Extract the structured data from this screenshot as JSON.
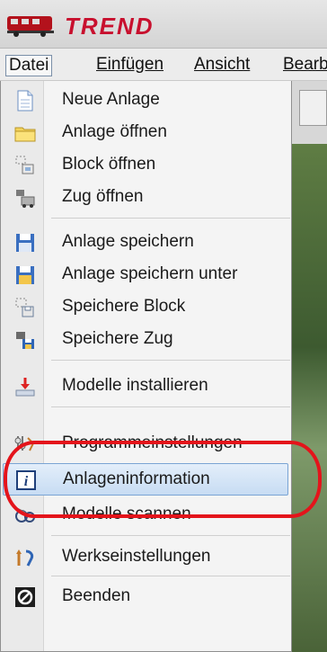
{
  "app": {
    "brand": "TREND"
  },
  "menubar": [
    "Datei",
    "Einfügen",
    "Ansicht",
    "Bearb"
  ],
  "menu_items": [
    {
      "label": "Neue Anlage",
      "icon": "new-document-icon"
    },
    {
      "label": "Anlage öffnen",
      "icon": "folder-icon"
    },
    {
      "label": "Block öffnen",
      "icon": "block-open-icon"
    },
    {
      "label": "Zug öffnen",
      "icon": "train-open-icon"
    },
    {
      "label": "Anlage speichern",
      "icon": "save-icon"
    },
    {
      "label": "Anlage speichern unter",
      "icon": "save-as-icon"
    },
    {
      "label": "Speichere Block",
      "icon": "save-block-icon"
    },
    {
      "label": "Speichere Zug",
      "icon": "save-train-icon"
    },
    {
      "label": "Modelle installieren",
      "icon": "install-icon"
    },
    {
      "label": "Programmeinstellungen",
      "icon": "program-settings-icon"
    },
    {
      "label": "Anlageninformation",
      "icon": "info-icon"
    },
    {
      "label": "Modelle scannen",
      "icon": "scan-icon"
    },
    {
      "label": "Werkseinstellungen",
      "icon": "factory-settings-icon"
    },
    {
      "label": "Beenden",
      "icon": "exit-icon"
    }
  ],
  "colors": {
    "highlight": "#c7dcf3",
    "annotation": "#e4141b",
    "brand": "#c8102e"
  }
}
